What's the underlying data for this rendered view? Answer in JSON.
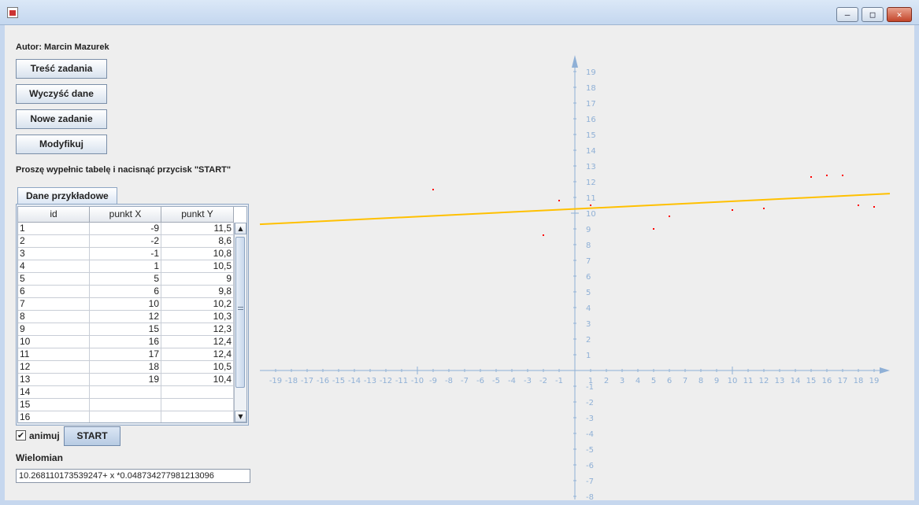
{
  "window": {
    "title": "",
    "controls": {
      "minimize": "–",
      "maximize": "□",
      "close": "✕"
    },
    "icon": "java-app-icon"
  },
  "author": "Autor: Marcin Mazurek",
  "buttons": {
    "task": "Treść zadania",
    "clear": "Wyczyść dane",
    "new_task": "Nowe zadanie",
    "modify": "Modyfikuj"
  },
  "instruction": "Proszę wypełnic tabelę i nacisnąć przycisk \"START\"",
  "tab_label": "Dane przykładowe",
  "table": {
    "headers": [
      "id",
      "punkt X",
      "punkt Y"
    ],
    "rows": [
      [
        "1",
        "-9",
        "11,5"
      ],
      [
        "2",
        "-2",
        "8,6"
      ],
      [
        "3",
        "-1",
        "10,8"
      ],
      [
        "4",
        "1",
        "10,5"
      ],
      [
        "5",
        "5",
        "9"
      ],
      [
        "6",
        "6",
        "9,8"
      ],
      [
        "7",
        "10",
        "10,2"
      ],
      [
        "8",
        "12",
        "10,3"
      ],
      [
        "9",
        "15",
        "12,3"
      ],
      [
        "10",
        "16",
        "12,4"
      ],
      [
        "11",
        "17",
        "12,4"
      ],
      [
        "12",
        "18",
        "10,5"
      ],
      [
        "13",
        "19",
        "10,4"
      ],
      [
        "14",
        "",
        ""
      ],
      [
        "15",
        "",
        ""
      ],
      [
        "16",
        "",
        ""
      ]
    ]
  },
  "scroll": {
    "up": "▲",
    "down": "▼"
  },
  "animate": {
    "label": "animuj",
    "checked": true,
    "check_glyph": "✔"
  },
  "start_label": "START",
  "polynomial": {
    "label": "Wielomian",
    "value": "10.268110173539247+ x *0.048734277981213096"
  },
  "chart_data": {
    "type": "scatter",
    "points": [
      {
        "x": -9,
        "y": 11.5
      },
      {
        "x": -2,
        "y": 8.6
      },
      {
        "x": -1,
        "y": 10.8
      },
      {
        "x": 1,
        "y": 10.5
      },
      {
        "x": 5,
        "y": 9
      },
      {
        "x": 6,
        "y": 9.8
      },
      {
        "x": 10,
        "y": 10.2
      },
      {
        "x": 12,
        "y": 10.3
      },
      {
        "x": 15,
        "y": 12.3
      },
      {
        "x": 16,
        "y": 12.4
      },
      {
        "x": 17,
        "y": 12.4
      },
      {
        "x": 18,
        "y": 10.5
      },
      {
        "x": 19,
        "y": 10.4
      }
    ],
    "fit_line": {
      "intercept": 10.268110173539247,
      "slope": 0.048734277981213096,
      "x_range": [
        -20,
        20
      ]
    },
    "x_ticks": [
      -19,
      -18,
      -17,
      -16,
      -15,
      -14,
      -13,
      -12,
      -11,
      -10,
      -9,
      -8,
      -7,
      -6,
      -5,
      -4,
      -3,
      -2,
      -1,
      1,
      2,
      3,
      4,
      5,
      6,
      7,
      8,
      9,
      10,
      11,
      12,
      13,
      14,
      15,
      16,
      17,
      18,
      19
    ],
    "y_ticks": [
      -8,
      -7,
      -6,
      -5,
      -4,
      -3,
      -2,
      -1,
      1,
      2,
      3,
      4,
      5,
      6,
      7,
      8,
      9,
      10,
      11,
      12,
      13,
      14,
      15,
      16,
      17,
      18,
      19
    ],
    "xlim": [
      -20,
      20
    ],
    "ylim": [
      -8,
      20
    ],
    "colors": {
      "axis": "#8fb0d6",
      "points": "#ff0000",
      "line": "#ffc000"
    },
    "title": "",
    "xlabel": "",
    "ylabel": ""
  }
}
